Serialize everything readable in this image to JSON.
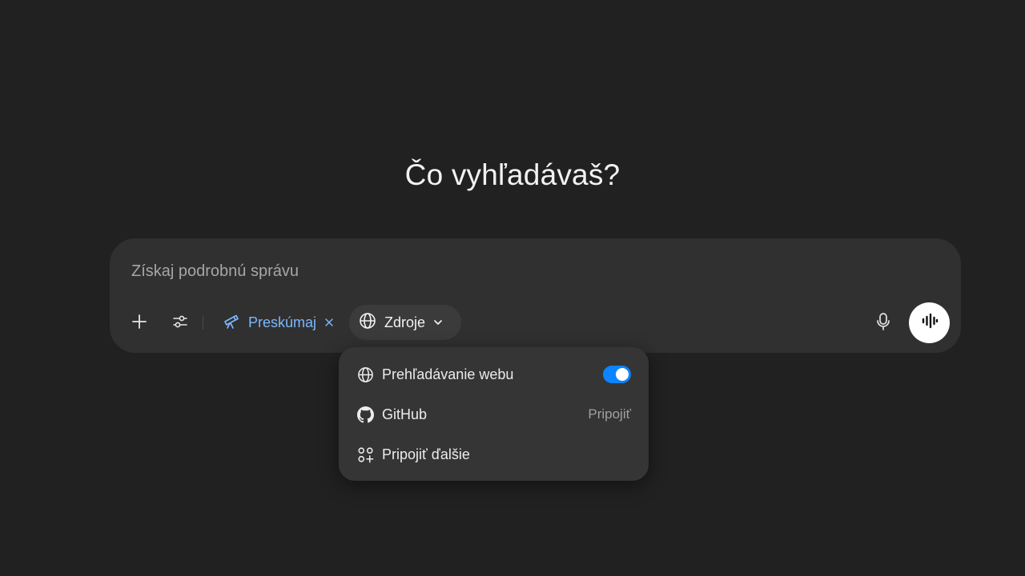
{
  "headline": "Čo vyhľadávaš?",
  "composer": {
    "placeholder": "Získaj podrobnú správu",
    "value": ""
  },
  "toolbar": {
    "add_icon": "plus-icon",
    "tools_icon": "sliders-icon",
    "explore": {
      "label": "Preskúmaj",
      "icon": "telescope-icon",
      "color": "#7ab7ff"
    },
    "sources": {
      "label": "Zdroje",
      "icon": "globe-icon"
    },
    "mic_icon": "microphone-icon",
    "voice_icon": "waveform-icon"
  },
  "sources_menu": {
    "items": [
      {
        "label": "Prehľadávanie webu",
        "icon": "globe-icon",
        "toggle": true,
        "toggle_on": true,
        "accent": "#0a84ff"
      },
      {
        "label": "GitHub",
        "icon": "github-icon",
        "action": "Pripojiť"
      },
      {
        "label": "Pripojiť ďalšie",
        "icon": "apps-plus-icon"
      }
    ]
  }
}
